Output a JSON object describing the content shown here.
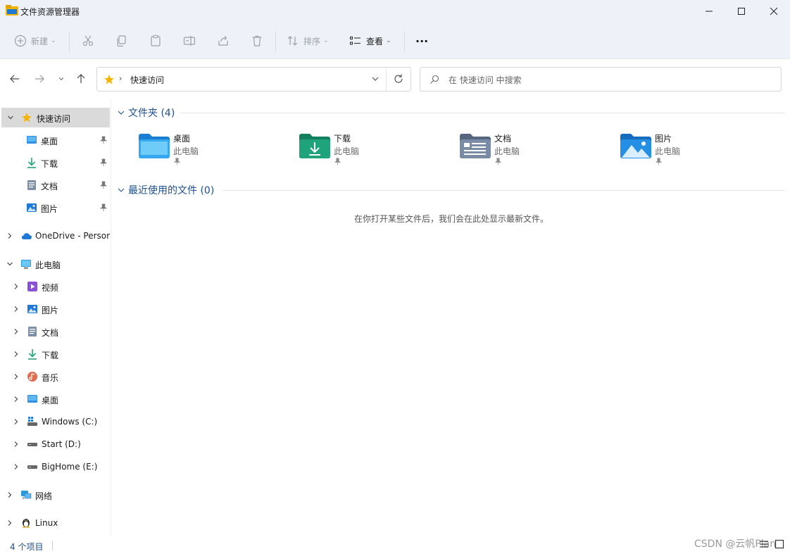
{
  "window": {
    "title": "文件资源管理器",
    "minimize_icon": "minimize-icon",
    "maximize_icon": "maximize-icon",
    "close_icon": "close-icon"
  },
  "toolbar": {
    "new_label": "新建",
    "sort_label": "排序",
    "view_label": "查看",
    "more_label": "···"
  },
  "address": {
    "crumb": "快速访问",
    "search_placeholder": "在 快速访问 中搜索"
  },
  "sidebar": {
    "quick_access": "快速访问",
    "quick_items": [
      "桌面",
      "下载",
      "文档",
      "图片"
    ],
    "onedrive": "OneDrive - Persor",
    "this_pc": "此电脑",
    "pc_items": [
      "视频",
      "图片",
      "文档",
      "下载",
      "音乐",
      "桌面",
      "Windows (C:)",
      "Start (D:)",
      "BigHome (E:)"
    ],
    "network": "网络",
    "linux": "Linux"
  },
  "main": {
    "folders_header": "文件夹 (4)",
    "folders": [
      {
        "name": "桌面",
        "location": "此电脑"
      },
      {
        "name": "下载",
        "location": "此电脑"
      },
      {
        "name": "文档",
        "location": "此电脑"
      },
      {
        "name": "图片",
        "location": "此电脑"
      }
    ],
    "recent_header": "最近使用的文件 (0)",
    "recent_empty": "在你打开某些文件后，我们会在此处显示最新文件。"
  },
  "status": {
    "item_count": "4 个项目",
    "watermark": "CSDN @云帆Plan"
  },
  "colors": {
    "accent": "#1e4f8f",
    "folder_blue": "#2f8fe6",
    "folder_green": "#1fa37a",
    "folder_gray": "#6e7f97",
    "star": "#f3b400"
  }
}
